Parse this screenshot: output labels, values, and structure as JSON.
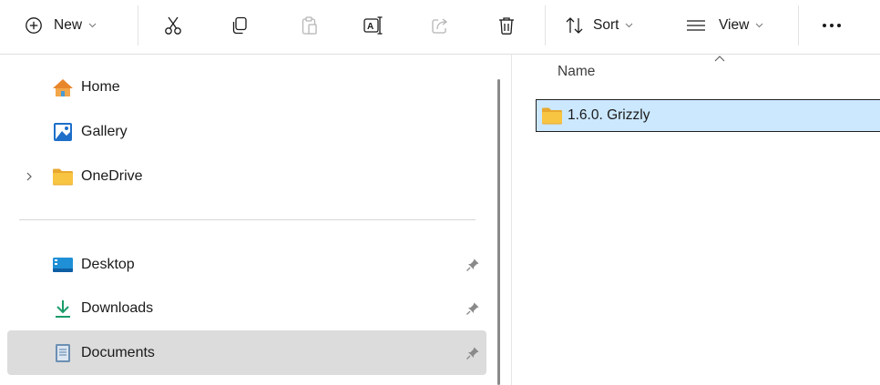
{
  "toolbar": {
    "new_label": "New",
    "sort_label": "Sort",
    "view_label": "View",
    "icons": [
      "add-circle-icon",
      "cut-icon",
      "copy-icon",
      "paste-icon",
      "rename-icon",
      "share-icon",
      "delete-icon",
      "sort-icon",
      "view-icon",
      "more-icon"
    ]
  },
  "nav": {
    "items": [
      {
        "label": "Home",
        "icon": "home-icon"
      },
      {
        "label": "Gallery",
        "icon": "gallery-icon"
      },
      {
        "label": "OneDrive",
        "icon": "folder-icon",
        "expandable": true
      }
    ],
    "quick_access": [
      {
        "label": "Desktop",
        "icon": "desktop-icon",
        "pinned": true
      },
      {
        "label": "Downloads",
        "icon": "download-icon",
        "pinned": true
      },
      {
        "label": "Documents",
        "icon": "documents-icon",
        "pinned": true,
        "selected": true
      }
    ]
  },
  "content": {
    "column_header": "Name",
    "sort_direction": "ascending",
    "files": [
      {
        "name": "1.6.0. Grizzly",
        "type": "folder",
        "selected": true
      }
    ]
  },
  "colors": {
    "selection": "#cce8ff",
    "nav_selected": "#dcdcdc",
    "folder": "#f8c543",
    "accent": "#0a7ad6"
  }
}
